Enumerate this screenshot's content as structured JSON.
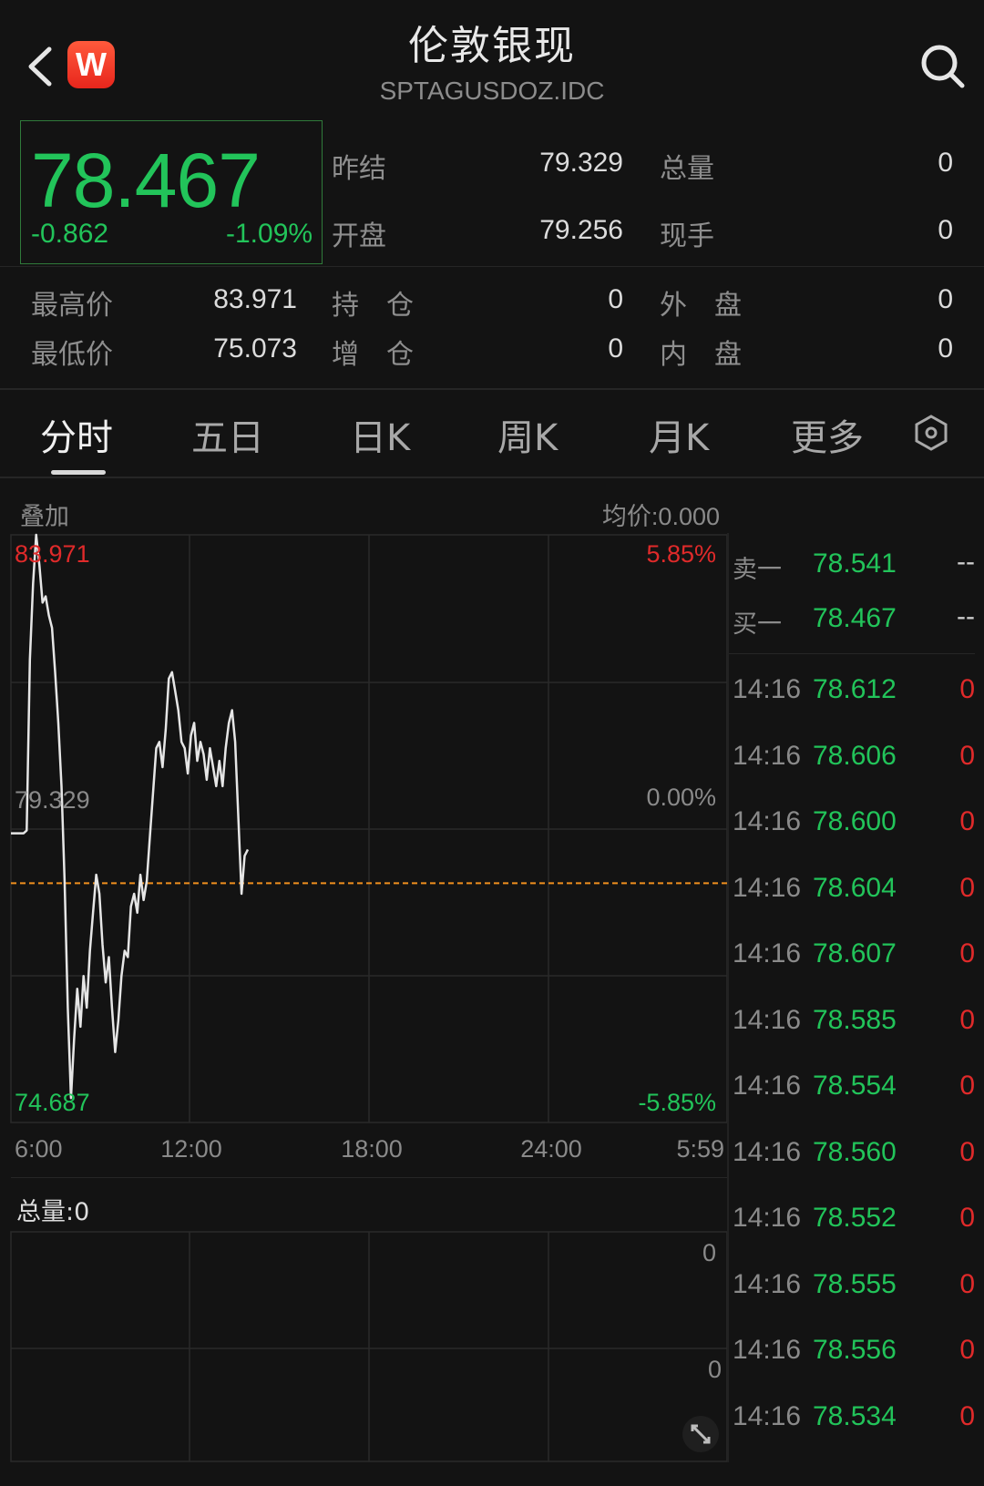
{
  "header": {
    "title": "伦敦银现",
    "code": "SPTAGUSDOZ.IDC",
    "logo_letter": "W"
  },
  "quote": {
    "price": "78.467",
    "change": "-0.862",
    "change_pct": "-1.09%"
  },
  "stats": [
    {
      "label": "昨结",
      "value": "79.329"
    },
    {
      "label": "总量",
      "value": "0"
    },
    {
      "label": "开盘",
      "value": "79.256"
    },
    {
      "label": "现手",
      "value": "0"
    },
    {
      "label": "最高价",
      "value": "83.971"
    },
    {
      "label": "持　仓",
      "value": "0"
    },
    {
      "label": "外　盘",
      "value": "0"
    },
    {
      "label": "最低价",
      "value": "75.073"
    },
    {
      "label": "增　仓",
      "value": "0"
    },
    {
      "label": "内　盘",
      "value": "0"
    }
  ],
  "tabs": [
    "分时",
    "五日",
    "日K",
    "周K",
    "月K",
    "更多"
  ],
  "chart_header": {
    "overlay": "叠加",
    "avg_price": "均价:0.000"
  },
  "chart_data": {
    "type": "line",
    "x_ticks": [
      "6:00",
      "12:00",
      "18:00",
      "24:00",
      "5:59"
    ],
    "ylim": [
      74.687,
      83.971
    ],
    "y_labels": {
      "top": "83.971",
      "mid": "79.329",
      "bottom": "74.687"
    },
    "pct_labels": {
      "top": "5.85%",
      "mid": "0.00%",
      "bottom": "-5.85%"
    },
    "reference_price": 79.329,
    "current_price": 78.467,
    "series": [
      {
        "values": [
          79.256,
          79.256,
          79.256,
          79.256,
          79.256,
          79.3,
          82.0,
          83.2,
          83.971,
          83.5,
          82.9,
          83.0,
          82.7,
          82.5,
          81.8,
          81.0,
          80.0,
          78.5,
          76.5,
          75.073,
          76.0,
          76.8,
          76.2,
          77.0,
          76.5,
          77.4,
          78.0,
          78.6,
          78.3,
          77.5,
          76.9,
          77.3,
          76.5,
          75.8,
          76.3,
          77.0,
          77.4,
          77.3,
          78.1,
          78.3,
          78.0,
          78.6,
          78.2,
          78.5,
          79.2,
          79.9,
          80.6,
          80.7,
          80.3,
          80.9,
          81.7,
          81.8,
          81.5,
          81.2,
          80.7,
          80.6,
          80.2,
          80.8,
          81.0,
          80.4,
          80.7,
          80.5,
          80.1,
          80.6,
          80.3,
          80.0,
          80.4,
          80.0,
          80.6,
          81.0,
          81.2,
          80.7,
          79.5,
          78.3,
          78.9,
          79.0
        ]
      }
    ]
  },
  "volume": {
    "label": "总量:0",
    "tick_top": "0",
    "tick_mid": "0"
  },
  "order_book": [
    {
      "label": "卖一",
      "price": "78.541",
      "vol": "--"
    },
    {
      "label": "买一",
      "price": "78.467",
      "vol": "--"
    }
  ],
  "trades": [
    {
      "time": "14:16",
      "price": "78.612",
      "vol": "0"
    },
    {
      "time": "14:16",
      "price": "78.606",
      "vol": "0"
    },
    {
      "time": "14:16",
      "price": "78.600",
      "vol": "0"
    },
    {
      "time": "14:16",
      "price": "78.604",
      "vol": "0"
    },
    {
      "time": "14:16",
      "price": "78.607",
      "vol": "0"
    },
    {
      "time": "14:16",
      "price": "78.585",
      "vol": "0"
    },
    {
      "time": "14:16",
      "price": "78.554",
      "vol": "0"
    },
    {
      "time": "14:16",
      "price": "78.560",
      "vol": "0"
    },
    {
      "time": "14:16",
      "price": "78.552",
      "vol": "0"
    },
    {
      "time": "14:16",
      "price": "78.555",
      "vol": "0"
    },
    {
      "time": "14:16",
      "price": "78.556",
      "vol": "0"
    },
    {
      "time": "14:16",
      "price": "78.534",
      "vol": "0"
    }
  ],
  "colors": {
    "up": "#e02a2a",
    "down": "#22c45a",
    "line": "#e6e6e6",
    "ref": "#f0901e"
  }
}
